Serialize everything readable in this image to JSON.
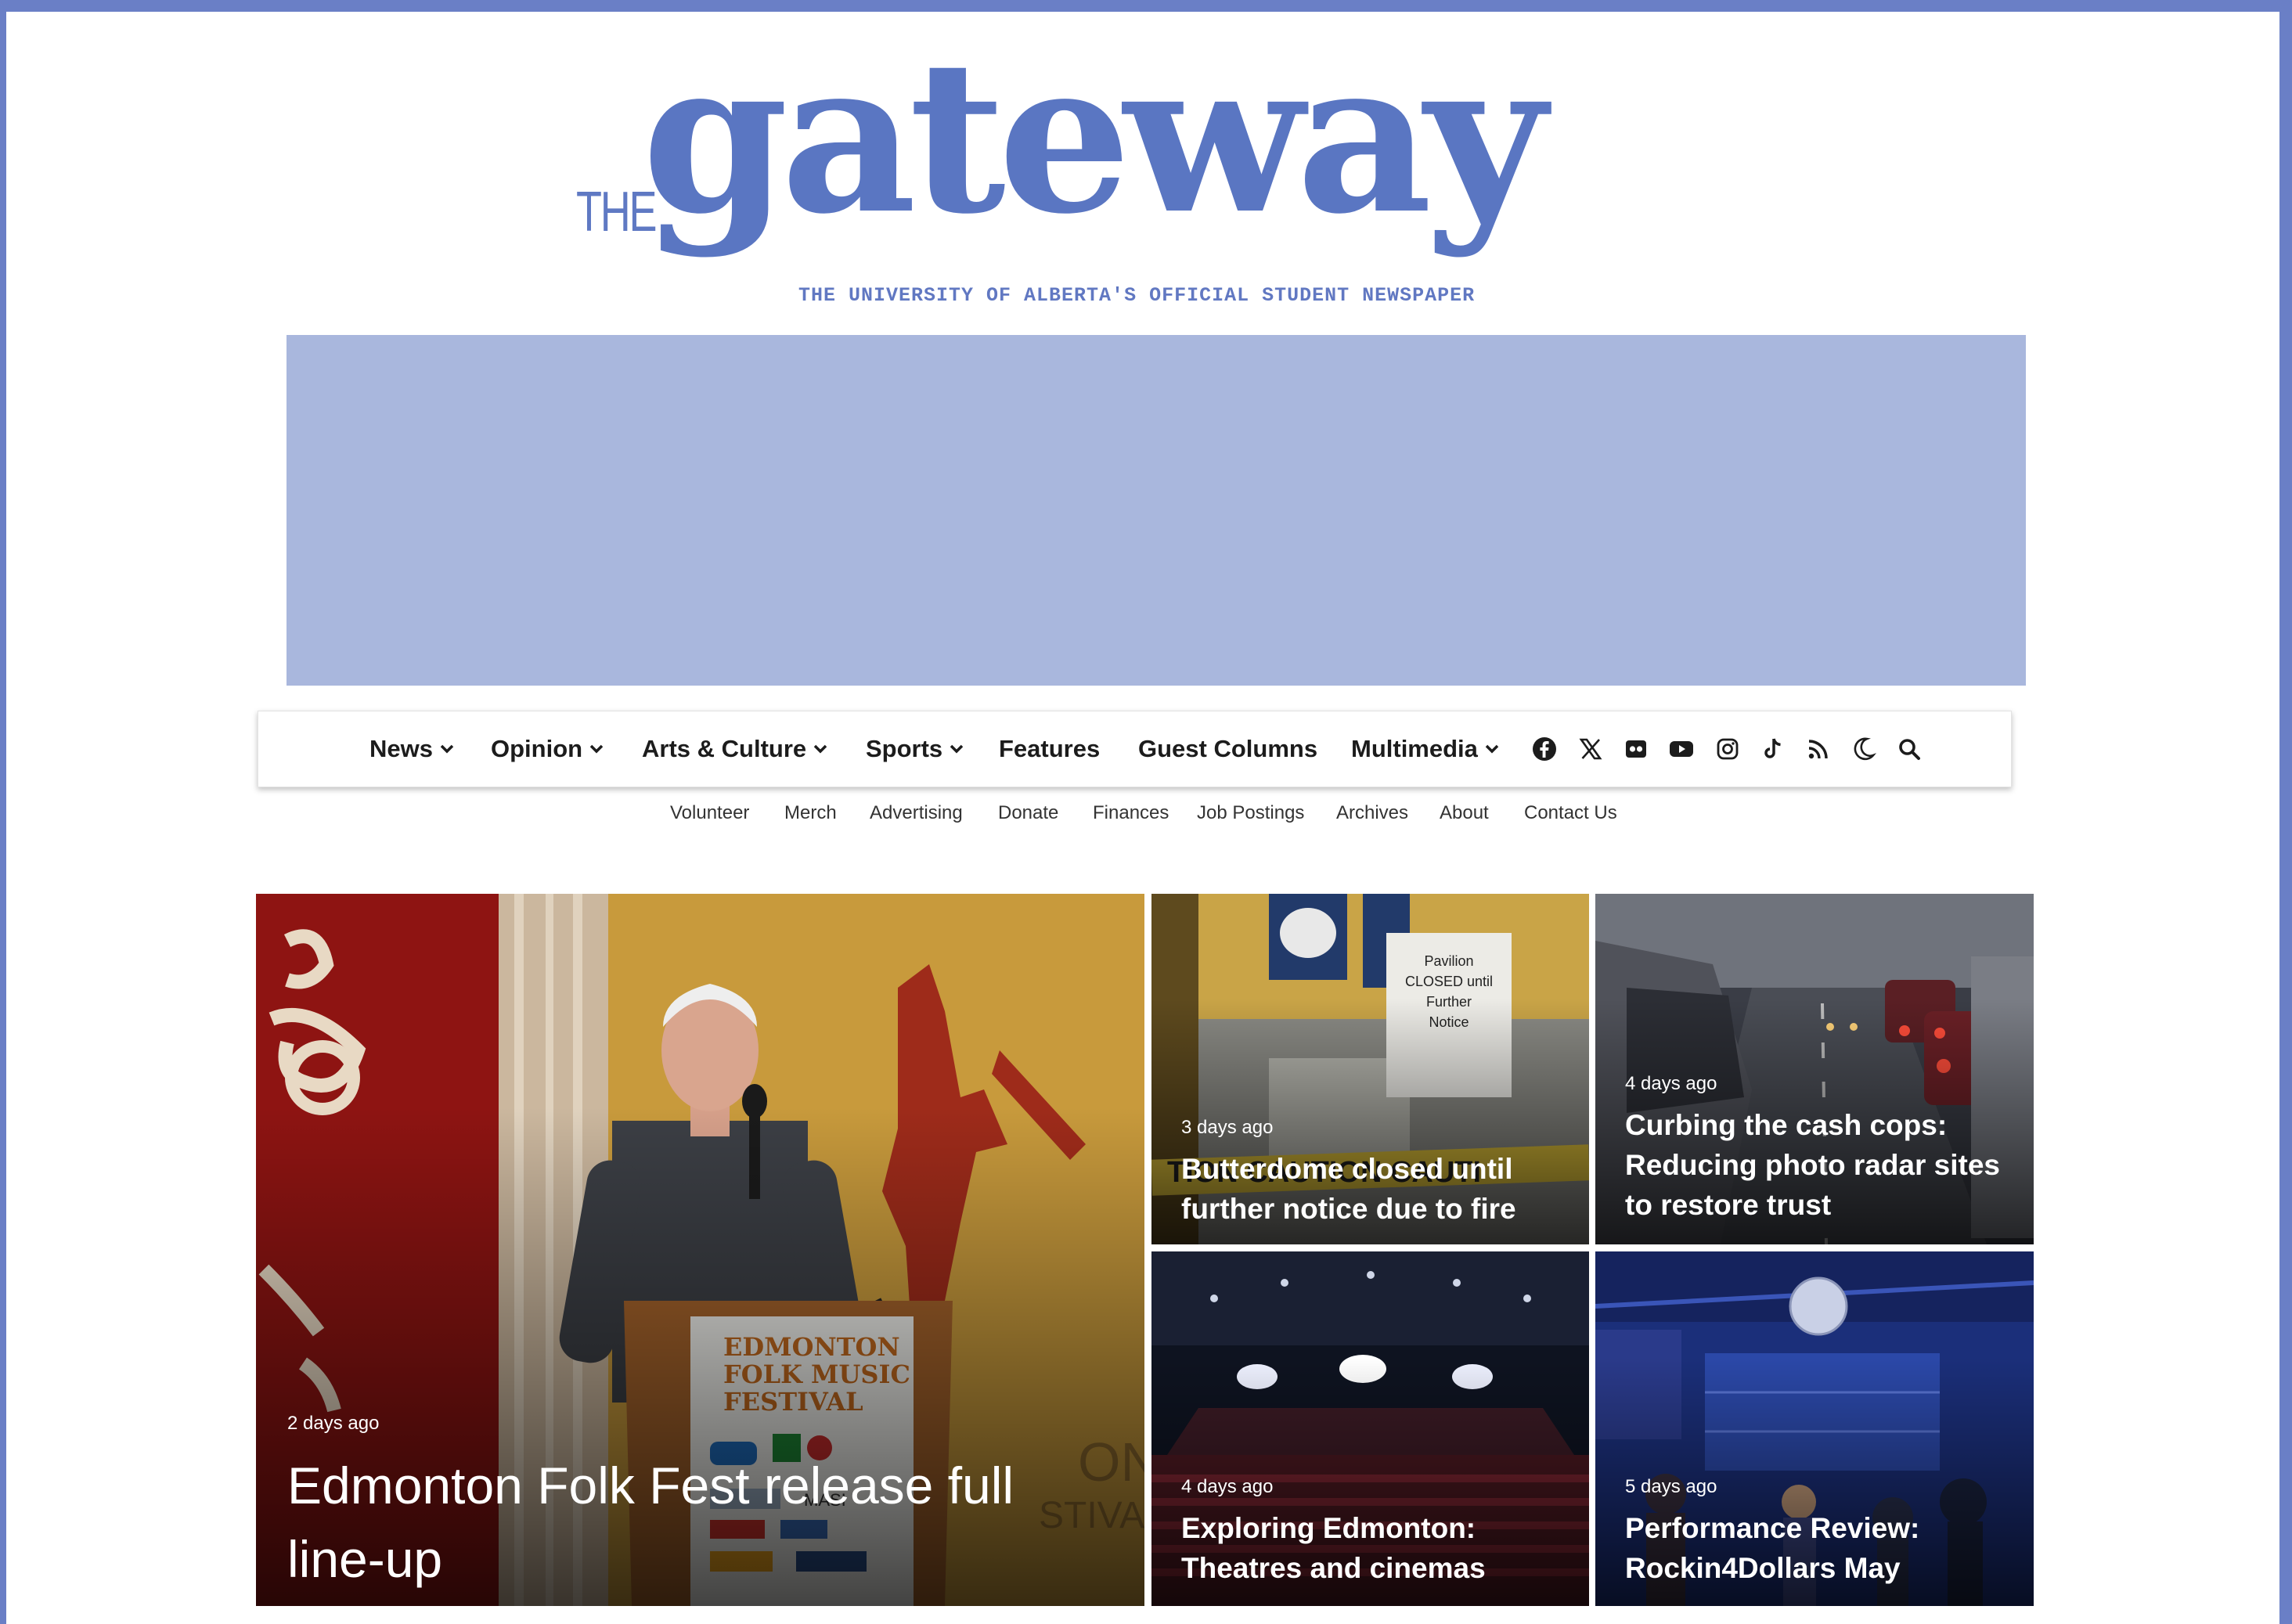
{
  "logo": {
    "the": "THE",
    "name": "gateway",
    "tagline": "THE UNIVERSITY OF ALBERTA'S OFFICIAL STUDENT NEWSPAPER"
  },
  "main_nav": {
    "items": [
      {
        "label": "News",
        "has_dropdown": true
      },
      {
        "label": "Opinion",
        "has_dropdown": true
      },
      {
        "label": "Arts & Culture",
        "has_dropdown": true
      },
      {
        "label": "Sports",
        "has_dropdown": true
      },
      {
        "label": "Features",
        "has_dropdown": false
      },
      {
        "label": "Guest Columns",
        "has_dropdown": false
      },
      {
        "label": "Multimedia",
        "has_dropdown": true
      }
    ],
    "icons": [
      "facebook-icon",
      "x-icon",
      "flickr-icon",
      "youtube-icon",
      "instagram-icon",
      "tiktok-icon",
      "rss-icon",
      "dark-mode-icon",
      "search-icon"
    ]
  },
  "secondary_nav": {
    "items": [
      "Volunteer",
      "Merch",
      "Advertising",
      "Donate",
      "Finances",
      "Job Postings",
      "Archives",
      "About",
      "Contact Us"
    ]
  },
  "featured": {
    "main": {
      "date": "2 days ago",
      "title": "Edmonton Folk Fest release full line-up"
    },
    "cards": [
      {
        "date": "3 days ago",
        "title": "Butterdome closed until further notice due to fire",
        "sign": "Pavilion CLOSED until Further Notice"
      },
      {
        "date": "4 days ago",
        "title": "Curbing the cash cops: Reducing photo radar sites to restore trust"
      },
      {
        "date": "4 days ago",
        "title": "Exploring Edmonton: Theatres and cinemas"
      },
      {
        "date": "5 days ago",
        "title": "Performance Review: Rockin4Dollars May"
      }
    ]
  },
  "colors": {
    "frame": "#6a7fc6",
    "brand_blue": "#5a76c2",
    "ad_placeholder": "#a9b7dd",
    "nav_text": "#1c1c1c"
  }
}
